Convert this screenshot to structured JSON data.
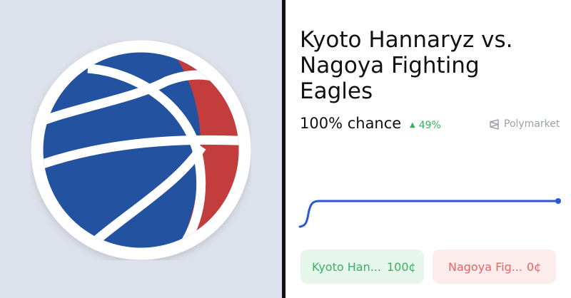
{
  "market": {
    "title": "Kyoto Hannaryz vs. Nagoya Fighting Eagles",
    "chance": "100% chance",
    "delta": "49%",
    "delta_direction": "up",
    "source": "Polymarket",
    "icon": "basketball-icon"
  },
  "outcomes": [
    {
      "label": "Kyoto Han...",
      "price": "100¢"
    },
    {
      "label": "Nagoya Fig...",
      "price": "0¢"
    }
  ],
  "colors": {
    "left_background": "#dde1ec",
    "ball_blue": "#2353a0",
    "ball_red": "#c33d3c",
    "line_blue": "#2b56d6",
    "yes_green": "#39b064",
    "no_red": "#e86565"
  }
}
